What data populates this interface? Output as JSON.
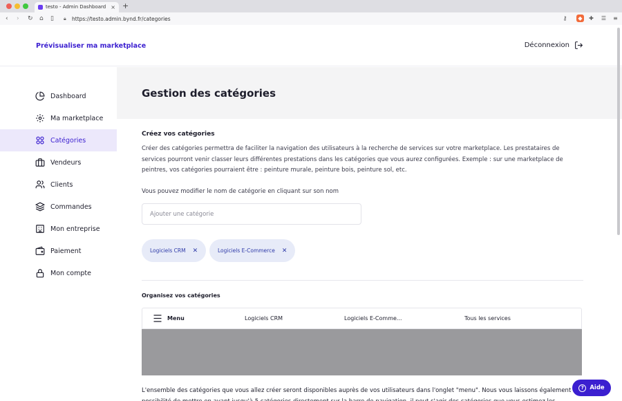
{
  "browser": {
    "tab_title": "testo - Admin Dashboard",
    "url": "https://testo.admin.bynd.fr/categories",
    "extension_badge": "3"
  },
  "header": {
    "preview_link": "Prévisualiser ma marketplace",
    "logout_label": "Déconnexion"
  },
  "sidebar": {
    "items": [
      {
        "label": "Dashboard",
        "icon": "pie-chart-icon"
      },
      {
        "label": "Ma marketplace",
        "icon": "gear-icon"
      },
      {
        "label": "Catégories",
        "icon": "grid-icon",
        "active": true
      },
      {
        "label": "Vendeurs",
        "icon": "briefcase-icon"
      },
      {
        "label": "Clients",
        "icon": "users-icon"
      },
      {
        "label": "Commandes",
        "icon": "layers-icon"
      },
      {
        "label": "Mon entreprise",
        "icon": "building-icon"
      },
      {
        "label": "Paiement",
        "icon": "wallet-icon"
      },
      {
        "label": "Mon compte",
        "icon": "lock-icon"
      }
    ]
  },
  "main": {
    "page_title": "Gestion des catégories",
    "create_title": "Créez vos catégories",
    "create_description": "Créer des catégories permettra de faciliter la navigation des utilisateurs à la recherche de services sur votre marketplace. Les prestataires de services pourront venir classer leurs différentes prestations dans les catégories que vous aurez configurées. Exemple : sur une marketplace de peintres, vos catégories pourraient être : peinture murale, peinture bois, peinture sol, etc.",
    "edit_hint": "Vous pouvez modifier le nom de catégorie en cliquant sur son nom",
    "input_placeholder": "Ajouter une catégorie",
    "chips": [
      "Logiciels CRM",
      "Logiciels E-Commerce"
    ],
    "organize_title": "Organisez vos catégories",
    "menu_bar": {
      "menu_label": "Menu",
      "items": [
        "Logiciels CRM",
        "Logiciels E-Comme...",
        "Tous les services"
      ]
    },
    "footer_text": "L'ensemble des catégories que vous allez créer seront disponibles auprès de vos utilisateurs dans l'onglet \"menu\". Nous vous laissons également la possibilité de mettre en avant jusqu'à 5 catégories directement sur la barre de navigation, il peut s'agir des catégories que vous estimez les"
  },
  "help": {
    "label": "Aide"
  },
  "colors": {
    "accent": "#3b1fd0",
    "active_bg": "#ece8fb",
    "chip_bg": "#e7ebf8",
    "title_band": "#f4f4f5"
  }
}
